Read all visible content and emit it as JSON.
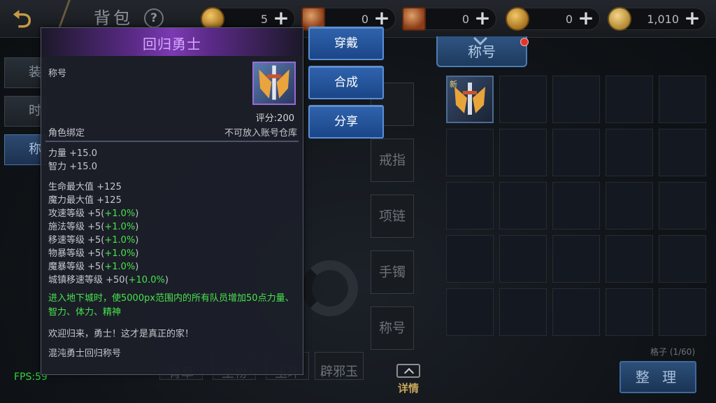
{
  "header": {
    "title": "背包",
    "help_icon": "question-icon",
    "currencies": [
      {
        "icon": "gold-coin-icon",
        "value": "5"
      },
      {
        "icon": "scroll-icon",
        "value": "0"
      },
      {
        "icon": "locked-scroll-icon",
        "value": "0"
      },
      {
        "icon": "coin-icon",
        "value": "0"
      },
      {
        "icon": "locked-coin-icon",
        "value": "1,010"
      }
    ],
    "plus_label": "+"
  },
  "side_tabs": [
    {
      "label": "装",
      "active": false
    },
    {
      "label": "时",
      "active": false
    },
    {
      "label": "称",
      "active": true
    }
  ],
  "equip_slots": [
    "",
    "戒指",
    "项链",
    "手镯",
    "称号"
  ],
  "bottom_slots": [
    "青草",
    "生物",
    "玉环",
    "辟邪玉"
  ],
  "inventory": {
    "tab_label": "称号",
    "new_badge": "新",
    "slot_count": "格子 (1/60)",
    "sort_label": "整 理"
  },
  "detail_toggle": "详情",
  "fps": "FPS:59",
  "tooltip": {
    "name": "回归勇士",
    "category": "称号",
    "score": "评分:200",
    "binding": "角色绑定",
    "storage": "不可放入账号仓库",
    "stats_primary": [
      "力量 +15.0",
      "智力 +15.0"
    ],
    "stats_secondary": [
      {
        "base": "生命最大值 +125",
        "bonus": ""
      },
      {
        "base": "魔力最大值 +125",
        "bonus": ""
      },
      {
        "base": "攻速等级 +5(",
        "bonus": "+1.0%",
        "tail": ")"
      },
      {
        "base": "施法等级 +5(",
        "bonus": "+1.0%",
        "tail": ")"
      },
      {
        "base": "移速等级 +5(",
        "bonus": "+1.0%",
        "tail": ")"
      },
      {
        "base": "物暴等级 +5(",
        "bonus": "+1.0%",
        "tail": ")"
      },
      {
        "base": "魔暴等级 +5(",
        "bonus": "+1.0%",
        "tail": ")"
      },
      {
        "base": "城镇移速等级 +50(",
        "bonus": "+10.0%",
        "tail": ")"
      }
    ],
    "effect": "进入地下城时，使5000px范围内的所有队员增加50点力量、智力、体力、精神",
    "flavor": "欢迎归来，勇士！这才是真正的家！",
    "source": "混沌勇士回归称号"
  },
  "actions": {
    "equip": "穿戴",
    "compose": "合成",
    "share": "分享"
  }
}
